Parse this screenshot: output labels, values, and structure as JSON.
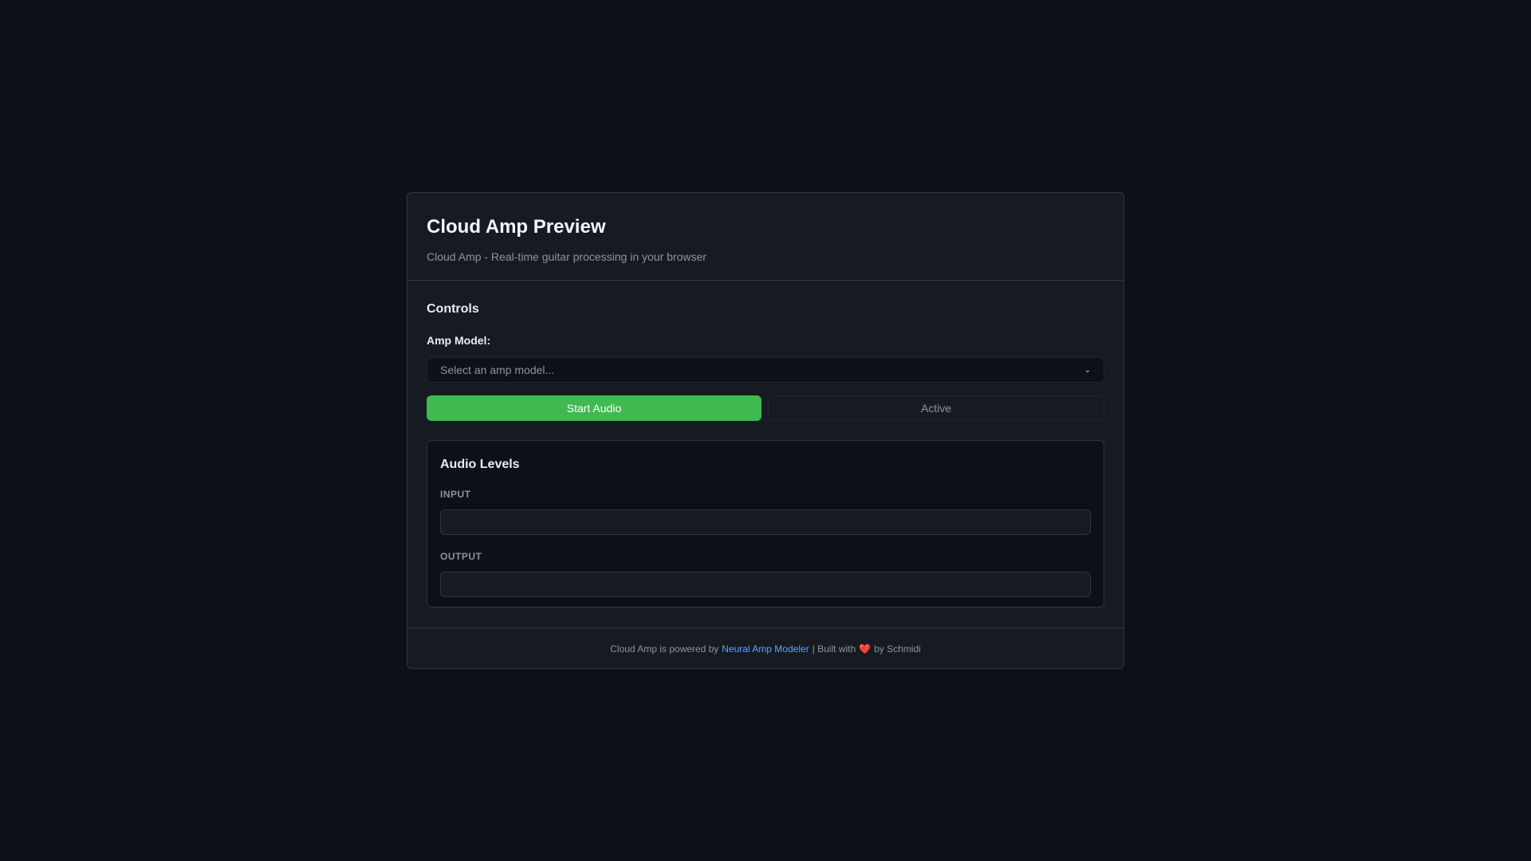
{
  "header": {
    "title": "Cloud Amp Preview",
    "subtitle": "Cloud Amp - Real-time guitar processing in your browser"
  },
  "controls": {
    "heading": "Controls",
    "amp_label": "Amp Model:",
    "amp_placeholder": "Select an amp model...",
    "start_label": "Start Audio",
    "status_label": "Active"
  },
  "levels": {
    "heading": "Audio Levels",
    "input_label": "INPUT",
    "output_label": "OUTPUT",
    "input_level": 0,
    "output_level": 0
  },
  "footer": {
    "prefix": "Cloud Amp is powered by",
    "link": "Neural Amp Modeler",
    "middle": "| Built with",
    "heart": "❤️",
    "suffix": "by Schmidi"
  },
  "colors": {
    "accent": "#3fb950",
    "link": "#58a6ff"
  }
}
